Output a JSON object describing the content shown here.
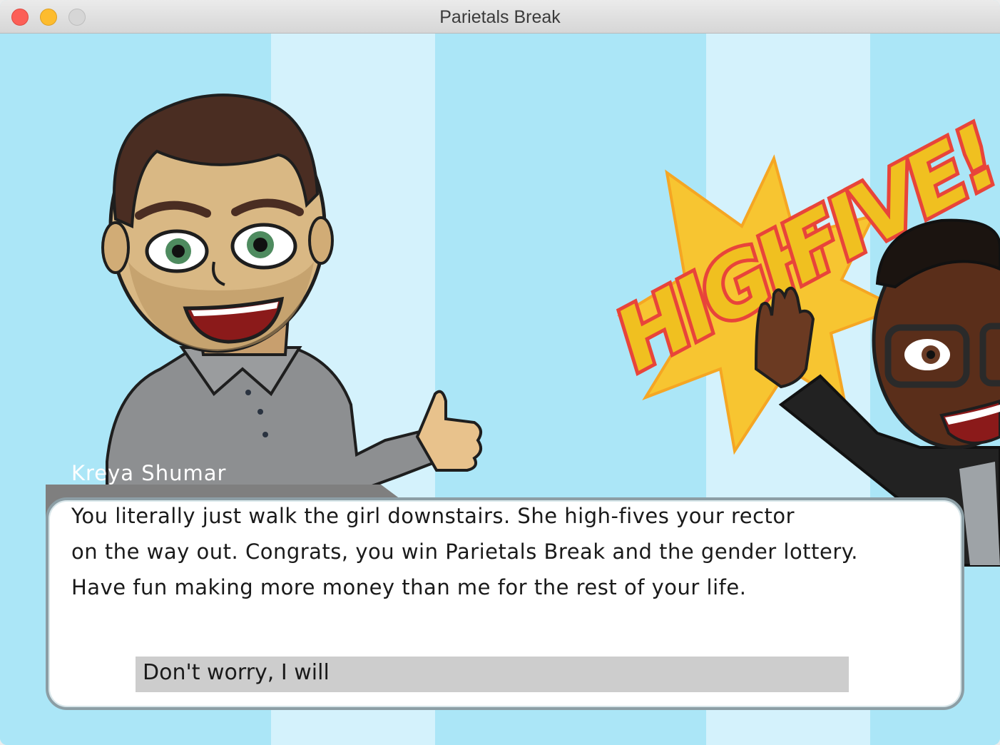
{
  "window": {
    "title": "Parietals Break"
  },
  "scene": {
    "left_character": "bitmoji-man-thumbs-up",
    "right_character": "bitmoji-man-glasses-high-five",
    "sticker_text": "HIGH FIVE!",
    "colors": {
      "background_blue": "#abe6f7",
      "stripe_light": "#d4f2fc",
      "sticker_yellow": "#f7c531",
      "sticker_red": "#e8443a"
    }
  },
  "dialog": {
    "speaker": "Kreya Shumar",
    "lines": [
      "You literally just walk the girl downstairs. She high-fives your rector",
      "on the way out. Congrats, you win Parietals Break and the gender lottery.",
      "Have fun making more money than me for the rest of your life."
    ],
    "choices": [
      "Don't worry, I will"
    ]
  }
}
